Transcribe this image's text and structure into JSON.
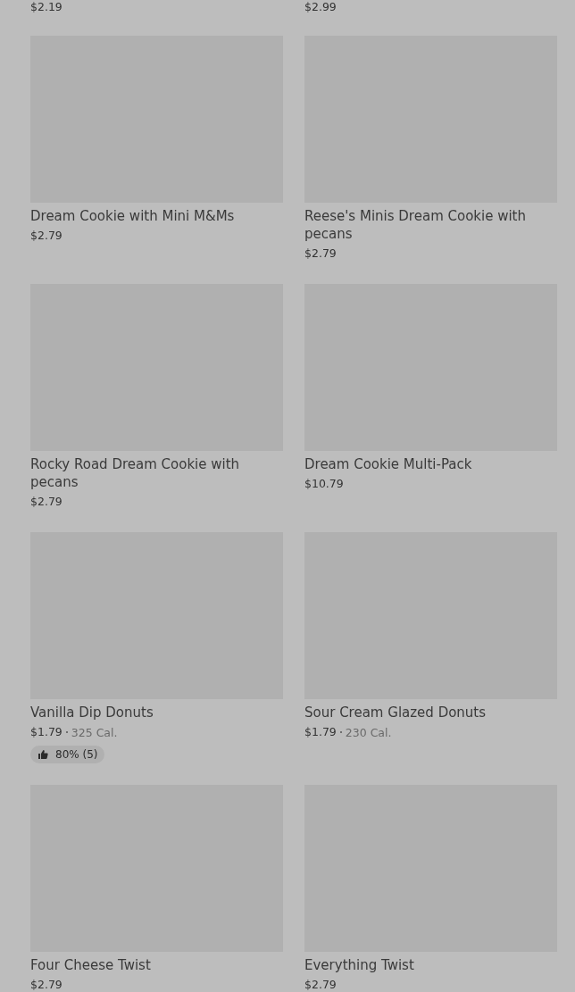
{
  "top_prices": [
    "$2.19",
    "$2.99"
  ],
  "products": [
    {
      "name": "Dream Cookie with Mini M&Ms",
      "price": "$2.79"
    },
    {
      "name": "Reese's Minis Dream Cookie with pecans",
      "price": "$2.79"
    },
    {
      "name": "Rocky Road Dream Cookie with pecans",
      "price": "$2.79"
    },
    {
      "name": "Dream Cookie Multi-Pack",
      "price": "$10.79"
    },
    {
      "name": "Vanilla Dip Donuts",
      "price": "$1.79",
      "calories": "325 Cal.",
      "rating": "80% (5)"
    },
    {
      "name": "Sour Cream Glazed Donuts",
      "price": "$1.79",
      "calories": "230 Cal."
    },
    {
      "name": "Four Cheese Twist",
      "price": "$2.79"
    },
    {
      "name": "Everything Twist",
      "price": "$2.79"
    }
  ]
}
